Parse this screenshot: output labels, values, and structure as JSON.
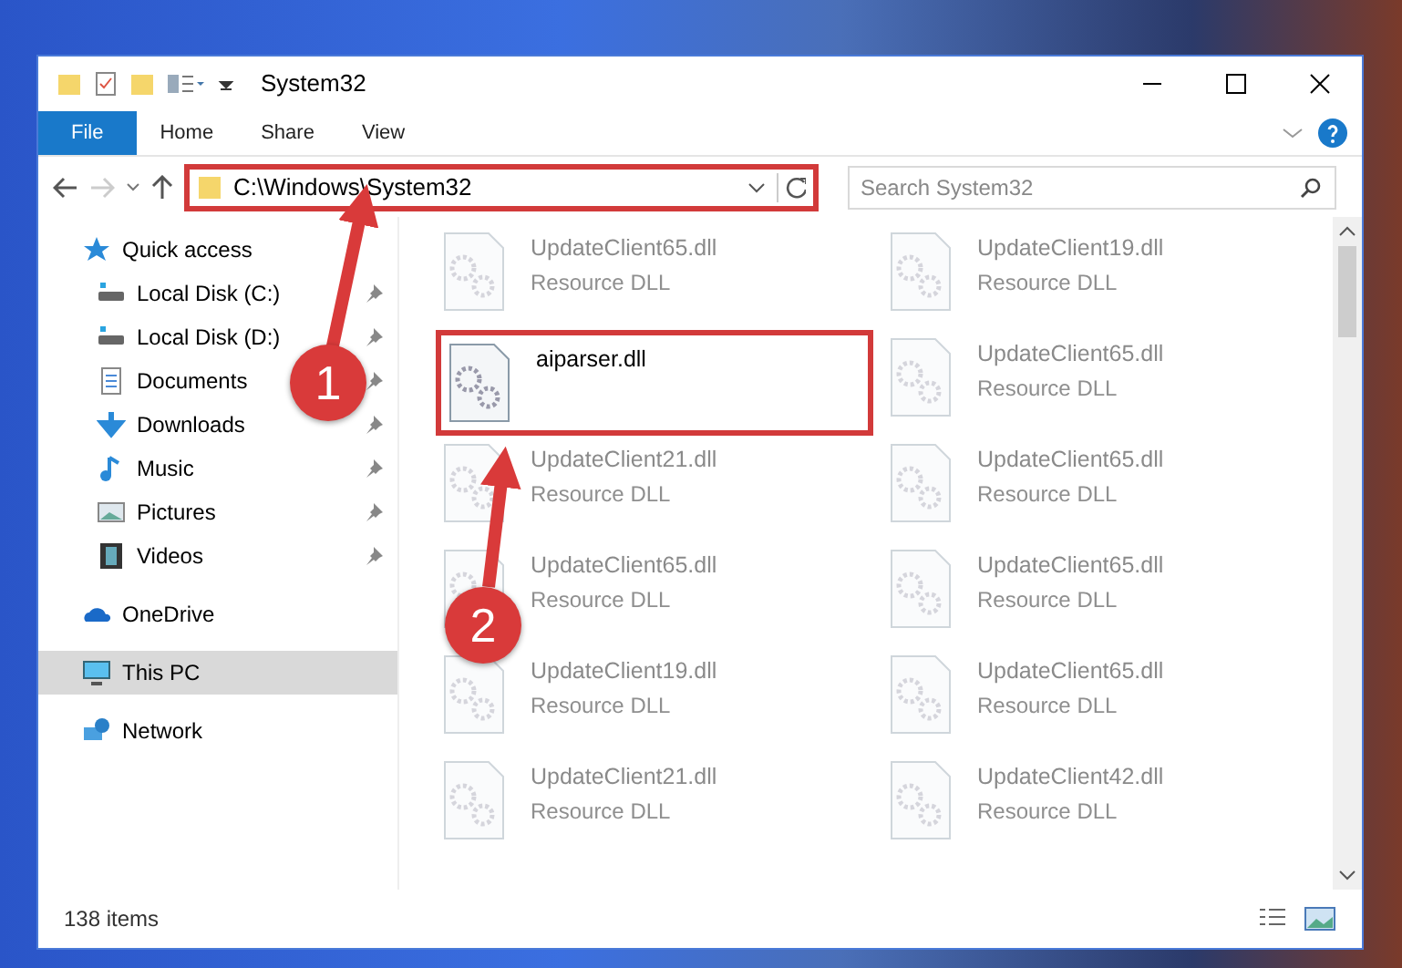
{
  "window": {
    "title": "System32"
  },
  "ribbon_tabs": [
    {
      "label": "File",
      "selected": true
    },
    {
      "label": "Home",
      "selected": false
    },
    {
      "label": "Share",
      "selected": false
    },
    {
      "label": "View",
      "selected": false
    }
  ],
  "address_bar": {
    "path": "C:\\Windows\\System32",
    "highlighted": true
  },
  "search": {
    "placeholder": "Search System32"
  },
  "sidebar": {
    "items": [
      {
        "label": "Quick access",
        "selected": false,
        "children": [
          {
            "label": "Local Disk (C:)",
            "pinned": true
          },
          {
            "label": "Local Disk (D:)",
            "pinned": true
          },
          {
            "label": "Documents",
            "pinned": true
          },
          {
            "label": "Downloads",
            "pinned": true
          },
          {
            "label": "Music",
            "pinned": true
          },
          {
            "label": "Pictures",
            "pinned": true
          },
          {
            "label": "Videos",
            "pinned": true
          }
        ]
      },
      {
        "label": "OneDrive",
        "selected": false
      },
      {
        "label": "This PC",
        "selected": true
      },
      {
        "label": "Network",
        "selected": false
      }
    ]
  },
  "files": [
    {
      "name": "UpdateClient65.dll",
      "type": "Resource DLL",
      "blurred": true,
      "highlighted": false
    },
    {
      "name": "UpdateClient19.dll",
      "type": "Resource DLL",
      "blurred": true,
      "highlighted": false
    },
    {
      "name": "aiparser.dll",
      "blurred": false,
      "highlighted": true
    },
    {
      "name": "UpdateClient65.dll",
      "type": "Resource DLL",
      "blurred": true,
      "highlighted": false
    },
    {
      "name": "UpdateClient21.dll",
      "type": "Resource DLL",
      "blurred": true,
      "highlighted": false
    },
    {
      "name": "UpdateClient65.dll",
      "type": "Resource DLL",
      "blurred": true,
      "highlighted": false
    },
    {
      "name": "UpdateClient65.dll",
      "type": "Resource DLL",
      "blurred": true,
      "highlighted": false
    },
    {
      "name": "UpdateClient65.dll",
      "type": "Resource DLL",
      "blurred": true,
      "highlighted": false
    },
    {
      "name": "UpdateClient19.dll",
      "type": "Resource DLL",
      "blurred": true,
      "highlighted": false
    },
    {
      "name": "UpdateClient65.dll",
      "type": "Resource DLL",
      "blurred": true,
      "highlighted": false
    },
    {
      "name": "UpdateClient21.dll",
      "type": "Resource DLL",
      "blurred": true,
      "highlighted": false
    },
    {
      "name": "UpdateClient42.dll",
      "type": "Resource DLL",
      "blurred": true,
      "highlighted": false
    }
  ],
  "status_bar": {
    "item_count": "138 items"
  },
  "callouts": [
    {
      "number": "1"
    },
    {
      "number": "2"
    }
  ]
}
